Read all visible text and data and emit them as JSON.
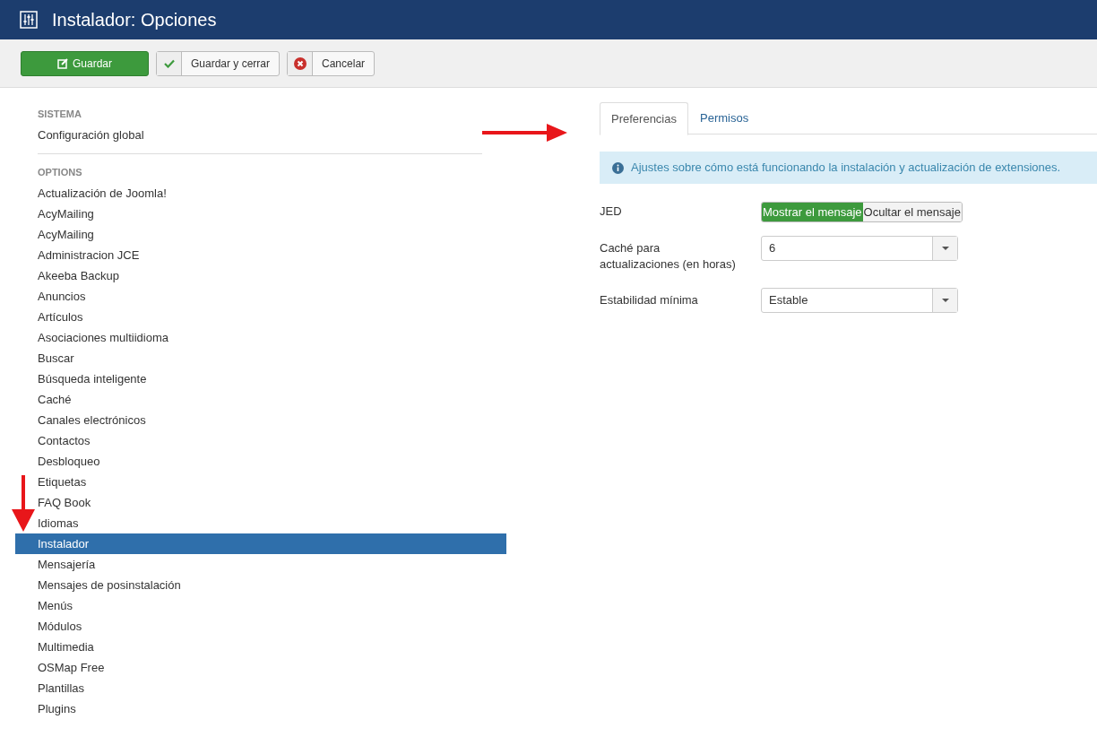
{
  "header": {
    "title": "Instalador: Opciones"
  },
  "toolbar": {
    "buttons": [
      {
        "label": "Guardar",
        "kind": "primary"
      },
      {
        "label": "Guardar y cerrar",
        "kind": "apply"
      },
      {
        "label": "Cancelar",
        "kind": "cancel"
      }
    ]
  },
  "sidebar": {
    "groups": [
      {
        "heading": "SISTEMA",
        "items": [
          {
            "label": "Configuración global",
            "selected": false
          }
        ]
      },
      {
        "heading": "OPTIONS",
        "items": [
          {
            "label": "Actualización de Joomla!",
            "selected": false
          },
          {
            "label": "AcyMailing",
            "selected": false
          },
          {
            "label": "AcyMailing",
            "selected": false
          },
          {
            "label": "Administracion JCE",
            "selected": false
          },
          {
            "label": "Akeeba Backup",
            "selected": false
          },
          {
            "label": "Anuncios",
            "selected": false
          },
          {
            "label": "Artículos",
            "selected": false
          },
          {
            "label": "Asociaciones multiidioma",
            "selected": false
          },
          {
            "label": "Buscar",
            "selected": false
          },
          {
            "label": "Búsqueda inteligente",
            "selected": false
          },
          {
            "label": "Caché",
            "selected": false
          },
          {
            "label": "Canales electrónicos",
            "selected": false
          },
          {
            "label": "Contactos",
            "selected": false
          },
          {
            "label": "Desbloqueo",
            "selected": false
          },
          {
            "label": "Etiquetas",
            "selected": false
          },
          {
            "label": "FAQ Book",
            "selected": false
          },
          {
            "label": "Idiomas",
            "selected": false
          },
          {
            "label": "Instalador",
            "selected": true
          },
          {
            "label": "Mensajería",
            "selected": false
          },
          {
            "label": "Mensajes de posinstalación",
            "selected": false
          },
          {
            "label": "Menús",
            "selected": false
          },
          {
            "label": "Módulos",
            "selected": false
          },
          {
            "label": "Multimedia",
            "selected": false
          },
          {
            "label": "OSMap Free",
            "selected": false
          },
          {
            "label": "Plantillas",
            "selected": false
          },
          {
            "label": "Plugins",
            "selected": false
          }
        ]
      }
    ]
  },
  "tabs": [
    {
      "label": "Preferencias",
      "selected": true
    },
    {
      "label": "Permisos",
      "selected": false
    }
  ],
  "alert": {
    "text": "Ajustes sobre cómo está funcionando la instalación y actualización de extensiones."
  },
  "fields": [
    {
      "label": "JED",
      "kind": "toggle",
      "options": [
        {
          "label": "Mostrar el mensaje",
          "selected": true
        },
        {
          "label": "Ocultar el mensaje",
          "selected": false
        }
      ]
    },
    {
      "label": "Caché para actualizaciones (en horas)",
      "kind": "select",
      "value": "6"
    },
    {
      "label": "Estabilidad mínima",
      "kind": "select",
      "value": "Estable"
    }
  ]
}
